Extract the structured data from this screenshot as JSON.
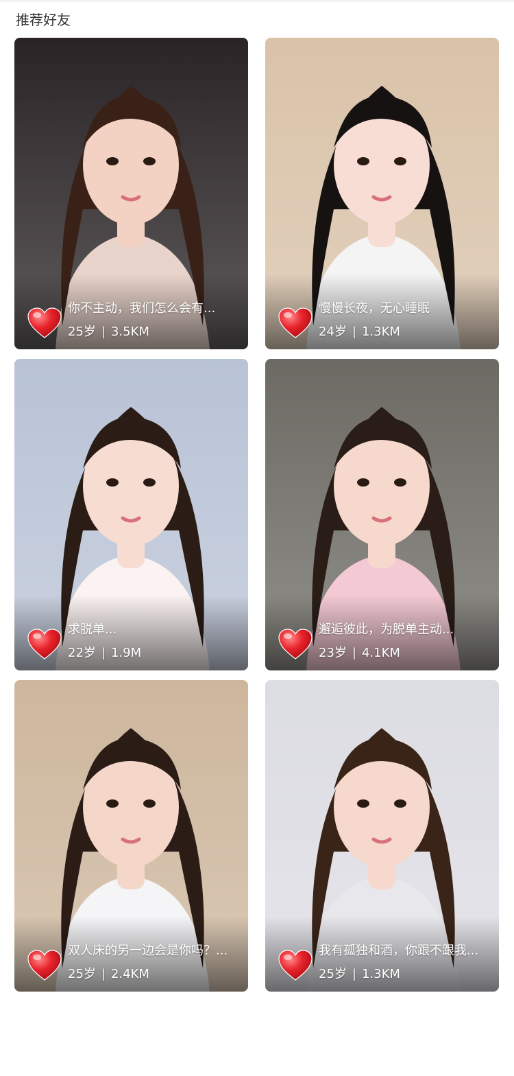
{
  "section": {
    "title": "推荐好友"
  },
  "cards": [
    {
      "motto": "你不主动，我们怎么会有...",
      "age": "25岁",
      "distance": "3.5KM",
      "photo": {
        "bg": "#2a2426",
        "hair": "#3a2118",
        "skin": "#f3d2c3",
        "cloth": "#e9d4cc"
      }
    },
    {
      "motto": "慢慢长夜，无心睡眠",
      "age": "24岁",
      "distance": "1.3KM",
      "photo": {
        "bg": "#d9c2a8",
        "hair": "#161212",
        "skin": "#f7ddd3",
        "cloth": "#f4f4f4"
      }
    },
    {
      "motto": "求脱单...",
      "age": "22岁",
      "distance": "1.9M",
      "photo": {
        "bg": "#b9c3d6",
        "hair": "#2b1c16",
        "skin": "#f7dcd1",
        "cloth": "#fbf3f2"
      }
    },
    {
      "motto": "邂逅彼此，为脱单主动...",
      "age": "23岁",
      "distance": "4.1KM",
      "photo": {
        "bg": "#6c6a63",
        "hair": "#2a1d18",
        "skin": "#f6d9cc",
        "cloth": "#f3c9d3"
      }
    },
    {
      "motto": "双人床的另一边会是你吗？...",
      "age": "25岁",
      "distance": "2.4KM",
      "photo": {
        "bg": "#cdb69c",
        "hair": "#2b1c16",
        "skin": "#f4d7c9",
        "cloth": "#f5f5f7"
      }
    },
    {
      "motto": "我有孤独和酒，你跟不跟我...",
      "age": "25岁",
      "distance": "1.3KM",
      "photo": {
        "bg": "#dcdce3",
        "hair": "#3a2418",
        "skin": "#f6d8cd",
        "cloth": "#e8e8ec"
      }
    }
  ],
  "icons": {
    "like": "heart-icon"
  },
  "colors": {
    "heart": "#e8242c",
    "overlay_text": "#ffffff",
    "title_text": "#333333"
  }
}
